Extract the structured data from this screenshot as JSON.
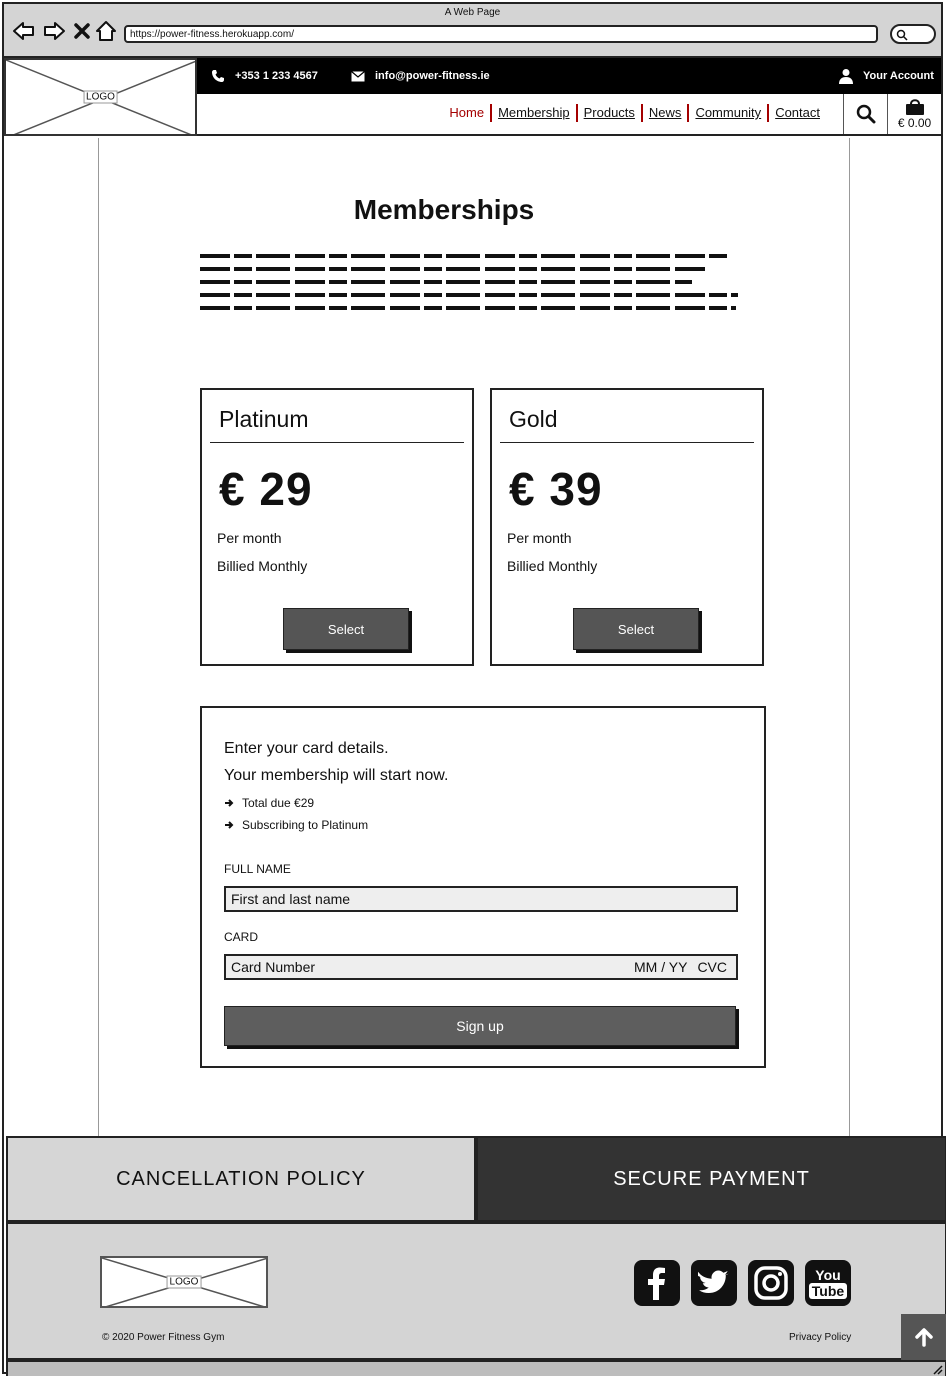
{
  "browser": {
    "window_title": "A Web Page",
    "url": "https://power-fitness.herokuapp.com/"
  },
  "header": {
    "logo_text": "LOGO",
    "phone": "+353 1 233 4567",
    "email": "info@power-fitness.ie",
    "account_label": "Your Account",
    "nav": [
      "Home",
      "Membership",
      "Products",
      "News",
      "Community",
      "Contact"
    ],
    "cart_total": "€ 0.00"
  },
  "main": {
    "title": "Memberships",
    "plans": [
      {
        "name": "Platinum",
        "price": "€ 29",
        "period": "Per month",
        "billing": "Billied Monthly",
        "button": "Select"
      },
      {
        "name": "Gold",
        "price": "€ 39",
        "period": "Per month",
        "billing": "Billied Monthly",
        "button": "Select"
      }
    ],
    "payment": {
      "heading1": "Enter your card details.",
      "heading2": "Your membership will start now.",
      "total_due": "Total due €29",
      "subscribing": "Subscribing to Platinum",
      "full_name_label": "FULL NAME",
      "full_name_placeholder": "First and last name",
      "card_label": "CARD",
      "card_number_placeholder": "Card Number",
      "card_expiry_placeholder": "MM / YY",
      "card_cvc_placeholder": "CVC",
      "submit_label": "Sign up"
    }
  },
  "bands": {
    "left": "CANCELLATION POLICY",
    "right": "SECURE PAYMENT"
  },
  "footer": {
    "logo_text": "LOGO",
    "copyright": "© 2020 Power Fitness Gym",
    "privacy": "Privacy Policy",
    "social_icons": [
      "facebook-icon",
      "twitter-icon",
      "instagram-icon",
      "youtube-icon"
    ],
    "youtube_text_1": "You",
    "youtube_text_2": "Tube"
  }
}
